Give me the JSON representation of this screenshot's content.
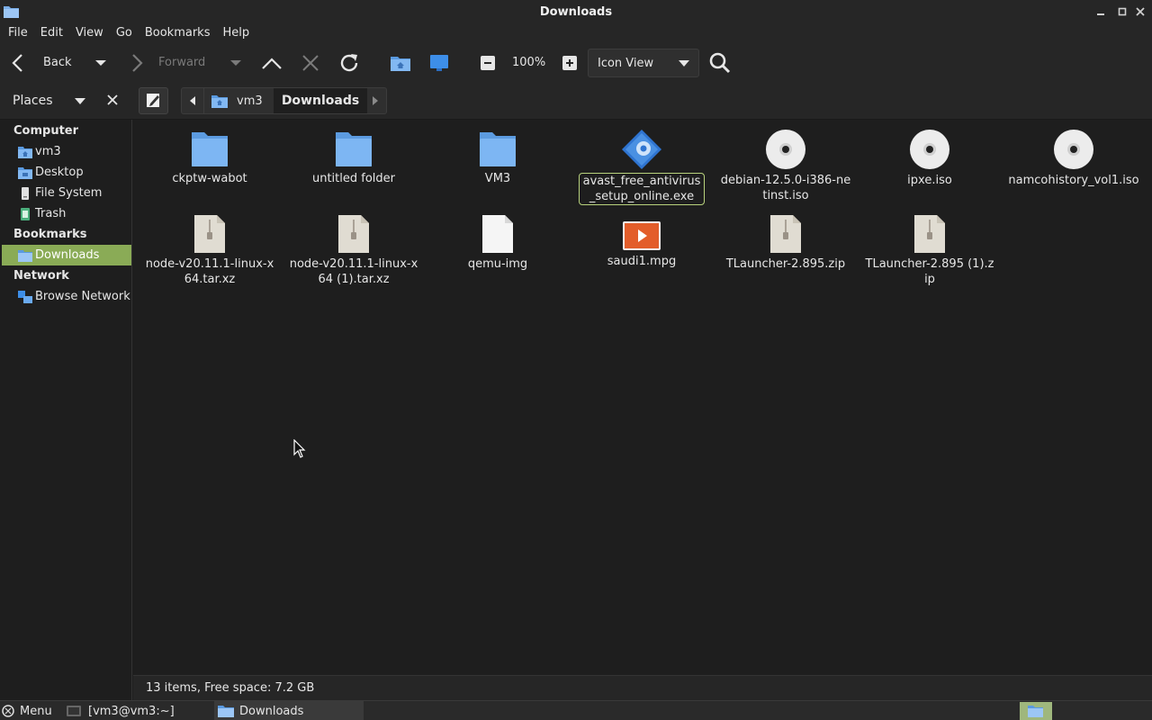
{
  "window": {
    "title": "Downloads"
  },
  "menu": [
    "File",
    "Edit",
    "View",
    "Go",
    "Bookmarks",
    "Help"
  ],
  "toolbar": {
    "back": "Back",
    "forward": "Forward",
    "zoom": "100%",
    "view_mode": "Icon View"
  },
  "location": {
    "places_label": "Places",
    "crumbs": [
      "vm3",
      "Downloads"
    ]
  },
  "sidebar": {
    "sections": [
      {
        "title": "Computer",
        "items": [
          "vm3",
          "Desktop",
          "File System",
          "Trash"
        ]
      },
      {
        "title": "Bookmarks",
        "items": [
          "Downloads"
        ]
      },
      {
        "title": "Network",
        "items": [
          "Browse Network"
        ]
      }
    ],
    "selected": "Downloads"
  },
  "files": [
    {
      "name": "ckptw-wabot",
      "type": "folder"
    },
    {
      "name": "untitled folder",
      "type": "folder"
    },
    {
      "name": "VM3",
      "type": "folder"
    },
    {
      "name": "avast_free_antivirus_setup_online.exe",
      "type": "exe",
      "selected": true
    },
    {
      "name": "debian-12.5.0-i386-netinst.iso",
      "type": "disc"
    },
    {
      "name": "ipxe.iso",
      "type": "disc"
    },
    {
      "name": "namcohistory_vol1.iso",
      "type": "disc"
    },
    {
      "name": "node-v20.11.1-linux-x64.tar.xz",
      "type": "archive"
    },
    {
      "name": "node-v20.11.1-linux-x64 (1).tar.xz",
      "type": "archive"
    },
    {
      "name": "qemu-img",
      "type": "blank"
    },
    {
      "name": "saudi1.mpg",
      "type": "video"
    },
    {
      "name": "TLauncher-2.895.zip",
      "type": "archive"
    },
    {
      "name": "TLauncher-2.895 (1).zip",
      "type": "archive"
    }
  ],
  "status": "13 items, Free space: 7.2 GB",
  "taskbar": {
    "menu": "Menu",
    "terminal": "[vm3@vm3:~]",
    "files": "Downloads"
  },
  "colors": {
    "accent": "#8aab56",
    "folder": "#78b3f3",
    "selection_border": "#b8d27d"
  }
}
